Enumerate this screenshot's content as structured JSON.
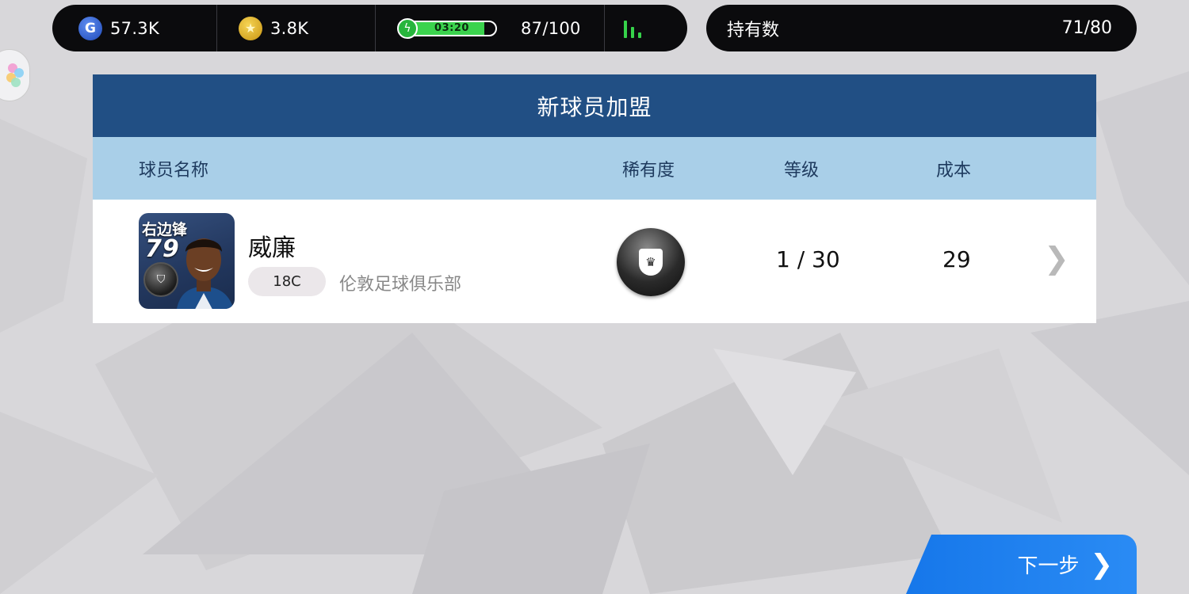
{
  "status_bar": {
    "gp_value": "57.3K",
    "coins_value": "3.8K",
    "energy_timer": "03:20",
    "energy_value": "87/100",
    "energy_fraction": 0.87
  },
  "owned": {
    "label": "持有数",
    "value": "71/80"
  },
  "panel": {
    "title": "新球员加盟",
    "headers": {
      "player_name": "球员名称",
      "rarity": "稀有度",
      "level": "等级",
      "cost": "成本"
    },
    "player": {
      "position": "右边锋",
      "rating": "79",
      "name": "威廉",
      "age": "18C",
      "club": "伦敦足球俱乐部",
      "level": "1 / 30",
      "cost": "29"
    }
  },
  "next_button": {
    "label": "下一步"
  },
  "colors": {
    "title_bar": "#214f84",
    "header_bar": "#a9cfe8",
    "energy_fill": "#3bd34d",
    "next_button": "#1677ea"
  },
  "icons": {
    "gp": "gp-coin-icon",
    "coins": "star-coin-icon",
    "energy": "lightning-icon",
    "signal": "signal-bars-icon",
    "row_arrow": "chevron-right-icon",
    "next": "chevron-right-icon"
  }
}
